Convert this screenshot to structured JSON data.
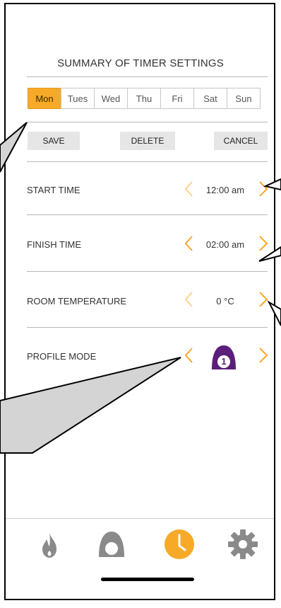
{
  "header": {
    "title": "SUMMARY OF TIMER SETTINGS"
  },
  "days": [
    {
      "label": "Mon",
      "active": true
    },
    {
      "label": "Tues",
      "active": false
    },
    {
      "label": "Wed",
      "active": false
    },
    {
      "label": "Thu",
      "active": false
    },
    {
      "label": "Fri",
      "active": false
    },
    {
      "label": "Sat",
      "active": false
    },
    {
      "label": "Sun",
      "active": false
    }
  ],
  "actions": {
    "save": "SAVE",
    "delete": "DELETE",
    "cancel": "CANCEL"
  },
  "settings": {
    "start_time": {
      "label": "START TIME",
      "value": "12:00 am"
    },
    "finish_time": {
      "label": "FINISH TIME",
      "value": "02:00 am"
    },
    "room_temperature": {
      "label": "ROOM TEMPERATURE",
      "value": "0 °C"
    },
    "profile_mode": {
      "label": "PROFILE MODE",
      "value": "1"
    }
  },
  "tabs": [
    {
      "name": "flame",
      "icon": "flame-icon",
      "active": false
    },
    {
      "name": "profile",
      "icon": "profile-icon",
      "active": false
    },
    {
      "name": "timer",
      "icon": "clock-icon",
      "active": true
    },
    {
      "name": "settings",
      "icon": "gear-icon",
      "active": false
    }
  ],
  "colors": {
    "accent": "#f7a928",
    "accent_light": "#fbd38e",
    "profile": "#5b1e7a",
    "icon_grey": "#8a8a8a",
    "callout_fill": "#d4d4d4"
  }
}
